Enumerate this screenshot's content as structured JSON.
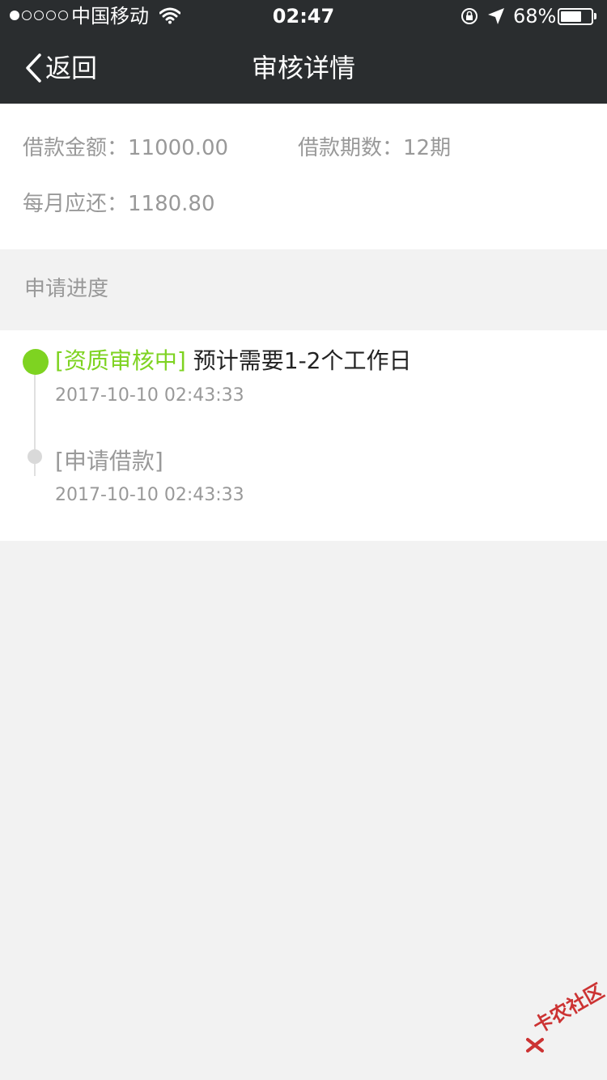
{
  "status_bar": {
    "carrier": "中国移动",
    "time": "02:47",
    "battery_percent_label": "68%",
    "battery_level": 0.68,
    "signal_dots_on": 1,
    "signal_dots_total": 5
  },
  "nav": {
    "back_label": "返回",
    "title": "审核详情"
  },
  "summary": {
    "amount": "借款金额：11000.00",
    "periods": "借款期数：12期",
    "monthly": "每月应还：1180.80"
  },
  "progress_section": {
    "title": "申请进度",
    "steps": [
      {
        "status": "[资质审核中]",
        "description": "预计需要1-2个工作日",
        "timestamp": "2017-10-10 02:43:33"
      },
      {
        "status": "[申请借款]",
        "timestamp": "2017-10-10 02:43:33"
      }
    ]
  },
  "watermark": {
    "text": "卡农社区"
  },
  "colors": {
    "nav_bg": "#2a2d2f",
    "accent_green": "#7ed321",
    "muted_text": "#999999",
    "page_bg": "#f2f2f2"
  }
}
